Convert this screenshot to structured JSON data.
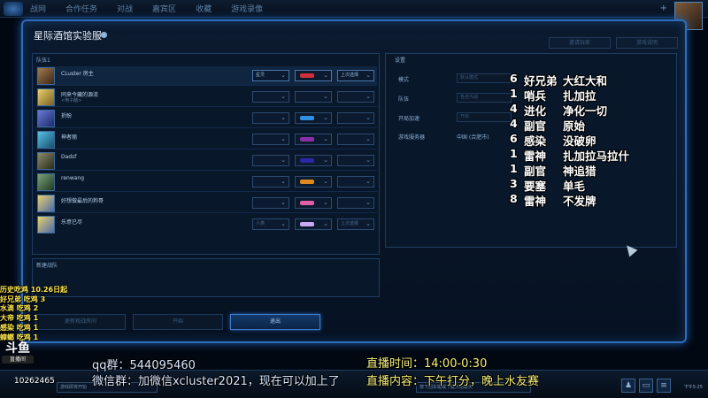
{
  "topnav": {
    "items": [
      "战网",
      "合作任务",
      "对战",
      "嘉宾区",
      "收藏",
      "游戏录像"
    ]
  },
  "dialog": {
    "title": "星际酒馆实验服",
    "header_buttons": [
      "邀请玩家",
      "游戏说明"
    ],
    "team": {
      "label": "队伍1",
      "players": [
        {
          "name": "CLuster 房主",
          "sub": "",
          "race": "星灵",
          "color": "#d0303a",
          "mode": "上次选择",
          "active": true
        },
        {
          "name": "同来今藏的源流",
          "sub": "<电子脑>",
          "race": "",
          "color": "",
          "mode": "",
          "active": false
        },
        {
          "name": "折盼",
          "sub": "",
          "race": "",
          "color": "#2f8fe0",
          "mode": "",
          "active": false
        },
        {
          "name": "神者丽",
          "sub": "",
          "race": "",
          "color": "#8a2fa8",
          "mode": "",
          "active": false
        },
        {
          "name": "Dadsf",
          "sub": "",
          "race": "",
          "color": "#2a2aa8",
          "mode": "",
          "active": false
        },
        {
          "name": "renwang",
          "sub": "",
          "race": "",
          "color": "#e08a20",
          "mode": "",
          "active": false
        },
        {
          "name": "好想做最后的狗哥",
          "sub": "",
          "race": "",
          "color": "#e060a8",
          "mode": "",
          "active": false
        },
        {
          "name": "乐意已尽",
          "sub": "",
          "race": "人类",
          "color": "#c8a8f0",
          "mode": "上次选择",
          "active": false
        }
      ]
    },
    "new_team_label": "新建战队",
    "bottom_buttons": {
      "b1": "更新观战房间",
      "b2": "开始",
      "exit": "退出"
    },
    "settings": {
      "title": "设置",
      "rows": [
        {
          "label": "模式",
          "value": "默认模式"
        },
        {
          "label": "队伍",
          "value": "各自为战"
        },
        {
          "label": "开局加速",
          "value": "开启"
        }
      ],
      "server_label": "游戏服务器",
      "server_value": "中国 (合肥市)"
    }
  },
  "overlay_list": [
    {
      "n": "6",
      "a": "好兄弟",
      "b": "大红大和"
    },
    {
      "n": "1",
      "a": "哨兵",
      "b": "扎加拉"
    },
    {
      "n": "4",
      "a": "进化",
      "b": "净化一切"
    },
    {
      "n": "4",
      "a": "副官",
      "b": "原始"
    },
    {
      "n": "6",
      "a": "感染",
      "b": "没破卵"
    },
    {
      "n": "1",
      "a": "雷神",
      "b": "扎加拉马拉什"
    },
    {
      "n": "1",
      "a": "副官",
      "b": "神追猎"
    },
    {
      "n": "3",
      "a": "要塞",
      "b": "单毛"
    },
    {
      "n": "8",
      "a": "雷神",
      "b": "不发牌"
    }
  ],
  "history": [
    "历史吃鸡 10.26日起",
    "好兄弟  吃鸡 3",
    "水滴    吃鸡 2",
    "大帝    吃鸡 1",
    "感染    吃鸡 1",
    "蟑螂    吃鸡 1"
  ],
  "douyu": {
    "logo": "斗鱼",
    "sub": "直播间",
    "room_id": "10262465"
  },
  "stream": {
    "qq": "qq群：544095460",
    "wechat": "微信群：加微信xcluster2021，现在可以加上了",
    "live_time": "直播时间：14:00-0:30",
    "live_content": "直播内容：下午打分，晚上水友赛"
  },
  "bottom_bar": {
    "chat_placeholder": "游戏即将开始",
    "chat2": "按下回车键或下键开始聊天",
    "clock": "下午5:25"
  }
}
